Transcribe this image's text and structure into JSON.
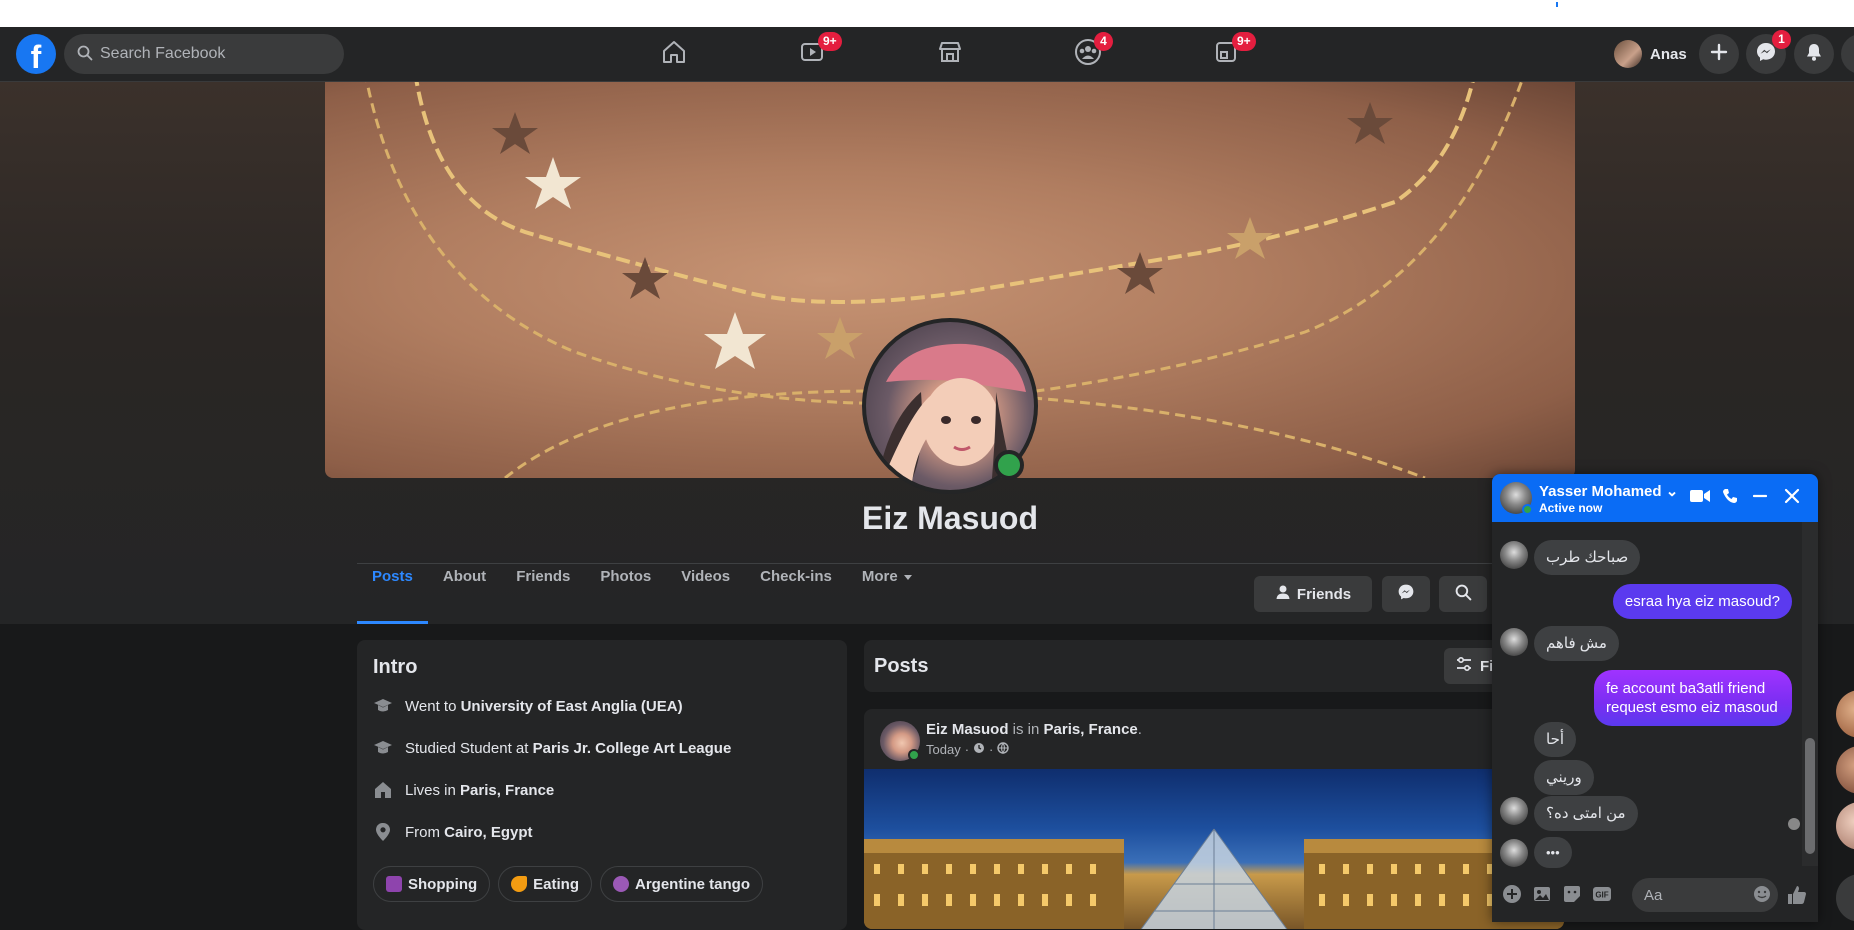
{
  "navbar": {
    "logo": "f",
    "search_placeholder": "Search Facebook",
    "watch_badge": "9+",
    "groups_badge": "4",
    "gaming_badge": "9+",
    "user_name": "Anas",
    "messenger_badge": "1"
  },
  "profile": {
    "name": "Eiz Masuod",
    "tabs": [
      "Posts",
      "About",
      "Friends",
      "Photos",
      "Videos",
      "Check-ins",
      "More"
    ],
    "friends_button": "Friends"
  },
  "intro": {
    "title": "Intro",
    "rows": [
      {
        "prefix": "Went to ",
        "value": "University of East Anglia (UEA)"
      },
      {
        "prefix": "Studied Student at ",
        "value": "Paris Jr. College Art League"
      },
      {
        "prefix": "Lives in ",
        "value": "Paris, France"
      },
      {
        "prefix": "From ",
        "value": "Cairo, Egypt"
      }
    ],
    "hobbies": [
      "Shopping",
      "Eating",
      "Argentine tango"
    ]
  },
  "posts": {
    "title": "Posts",
    "filter_label": "Filters",
    "post": {
      "author": "Eiz Masuod",
      "middle": " is in ",
      "place": "Paris, France",
      "end": ".",
      "time": "Today"
    }
  },
  "chat": {
    "contact": "Yasser Mohamed",
    "status": "Active now",
    "messages": [
      {
        "dir": "in",
        "text": "صباحك طرب"
      },
      {
        "dir": "out",
        "text": "esraa hya eiz masoud?"
      },
      {
        "dir": "in",
        "text": "مش فاهم"
      },
      {
        "dir": "out",
        "line1": "fe account ba3atli friend",
        "line2": "request esmo eiz masoud"
      },
      {
        "dir": "in",
        "text": "أحا"
      },
      {
        "dir": "in",
        "text": "وريني"
      },
      {
        "dir": "in",
        "text": "من امتى ده؟"
      },
      {
        "dir": "in",
        "text": "•••"
      }
    ],
    "composer_placeholder": "Aa"
  },
  "colors": {
    "accent": "#2d88ff",
    "brand": "#1877f2",
    "badge": "#e41e3f",
    "online": "#31a24c",
    "chat_header": "#0a6cf5"
  }
}
